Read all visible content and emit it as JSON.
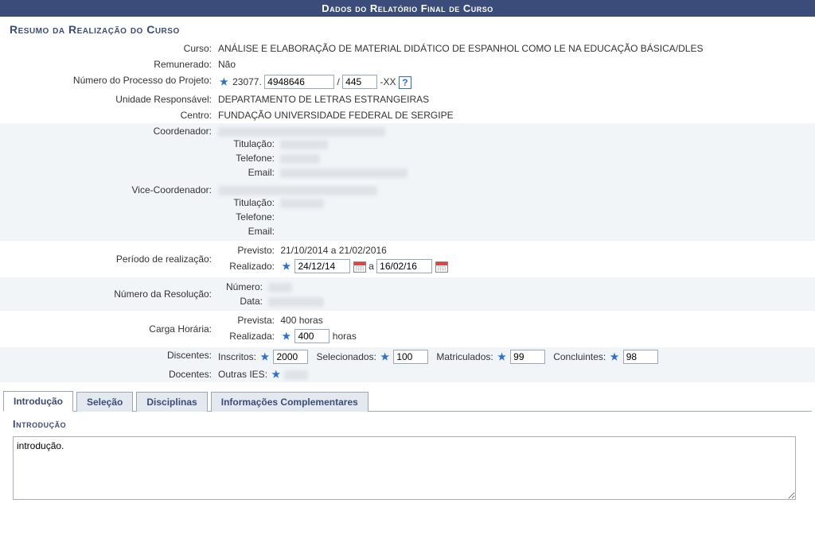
{
  "header": {
    "title": "Dados do Relatório Final de Curso"
  },
  "section": {
    "title": "Resumo da Realização do Curso"
  },
  "form": {
    "curso_label": "Curso:",
    "curso_value": "ANÁLISE E ELABORAÇÃO DE MATERIAL DIDÁTICO DE ESPANHOL COMO LE NA EDUCAÇÃO BÁSICA/DLES",
    "remunerado_label": "Remunerado:",
    "remunerado_value": "Não",
    "processo_label": "Número do Processo do Projeto:",
    "processo_prefix": "23077.",
    "processo_num1": "4948646",
    "processo_sep": " / ",
    "processo_num2": "445",
    "processo_suffix": "-XX",
    "unidade_label": "Unidade Responsável:",
    "unidade_value": "DEPARTAMENTO DE LETRAS ESTRANGEIRAS",
    "centro_label": "Centro:",
    "centro_value": "FUNDAÇÃO UNIVERSIDADE FEDERAL DE SERGIPE",
    "coord_label": "Coordenador:",
    "titulacao_label": "Titulação:",
    "telefone_label": "Telefone:",
    "email_label": "Email:",
    "vicecoord_label": "Vice-Coordenador:",
    "periodo_label": "Período de realização:",
    "periodo_previsto_label": "Previsto:",
    "periodo_previsto_value": "21/10/2014 a 21/02/2016",
    "periodo_realizado_label": "Realizado:",
    "periodo_data_ini": "24/12/14",
    "periodo_a": " a ",
    "periodo_data_fim": "16/02/16",
    "resolucao_label": "Número da Resolução:",
    "resolucao_numero_label": "Número:",
    "resolucao_data_label": "Data:",
    "carga_label": "Carga Horária:",
    "carga_prevista_label": "Prevista:",
    "carga_prevista_value": "400 horas",
    "carga_realizada_label": "Realizada:",
    "carga_realizada_value": "400",
    "carga_horas_suffix": " horas",
    "discentes_label": "Discentes:",
    "inscritos_label": "Inscritos:",
    "inscritos_value": "2000",
    "selecionados_label": "Selecionados:",
    "selecionados_value": "100",
    "matriculados_label": "Matriculados:",
    "matriculados_value": "99",
    "concluintes_label": "Concluintes:",
    "concluintes_value": "98",
    "docentes_label": "Docentes:",
    "docentes_outras_label": "Outras IES:"
  },
  "tabs": {
    "introducao": "Introdução",
    "selecao": "Seleção",
    "disciplinas": "Disciplinas",
    "info": "Informações Complementares"
  },
  "tab_body": {
    "title": "Introdução",
    "textarea_value": "introdução."
  },
  "help": {
    "symbol": "?"
  }
}
